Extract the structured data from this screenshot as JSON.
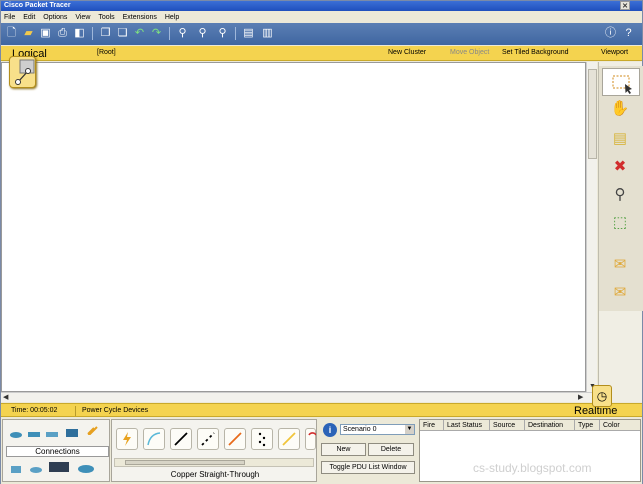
{
  "window": {
    "title": "Cisco Packet Tracer"
  },
  "menu": [
    "File",
    "Edit",
    "Options",
    "View",
    "Tools",
    "Extensions",
    "Help"
  ],
  "workspace_bar": {
    "mode": "Logical",
    "root": "[Root]",
    "new_cluster": "New Cluster",
    "move_object": "Move Object",
    "set_tiled": "Set Tiled Background",
    "viewport": "Viewport"
  },
  "status": {
    "time": "Time: 00:05:02",
    "power_cycle": "Power Cycle Devices",
    "mode": "Realtime"
  },
  "devices": {
    "category_label": "Connections"
  },
  "cables": {
    "selected_name": "Copper Straight-Through"
  },
  "scenario": {
    "selected": "Scenario 0",
    "new_label": "New",
    "delete_label": "Delete",
    "toggle_label": "Toggle PDU List Window"
  },
  "pdu_columns": [
    "Fire",
    "Last Status",
    "Source",
    "Destination",
    "Type",
    "Color"
  ],
  "watermark": "cs-study.blogspot.com",
  "colors": {
    "workspace_bar": "#f4d34f",
    "toolbar": "#3f66a1",
    "title_bar": "#1f4fbd"
  }
}
